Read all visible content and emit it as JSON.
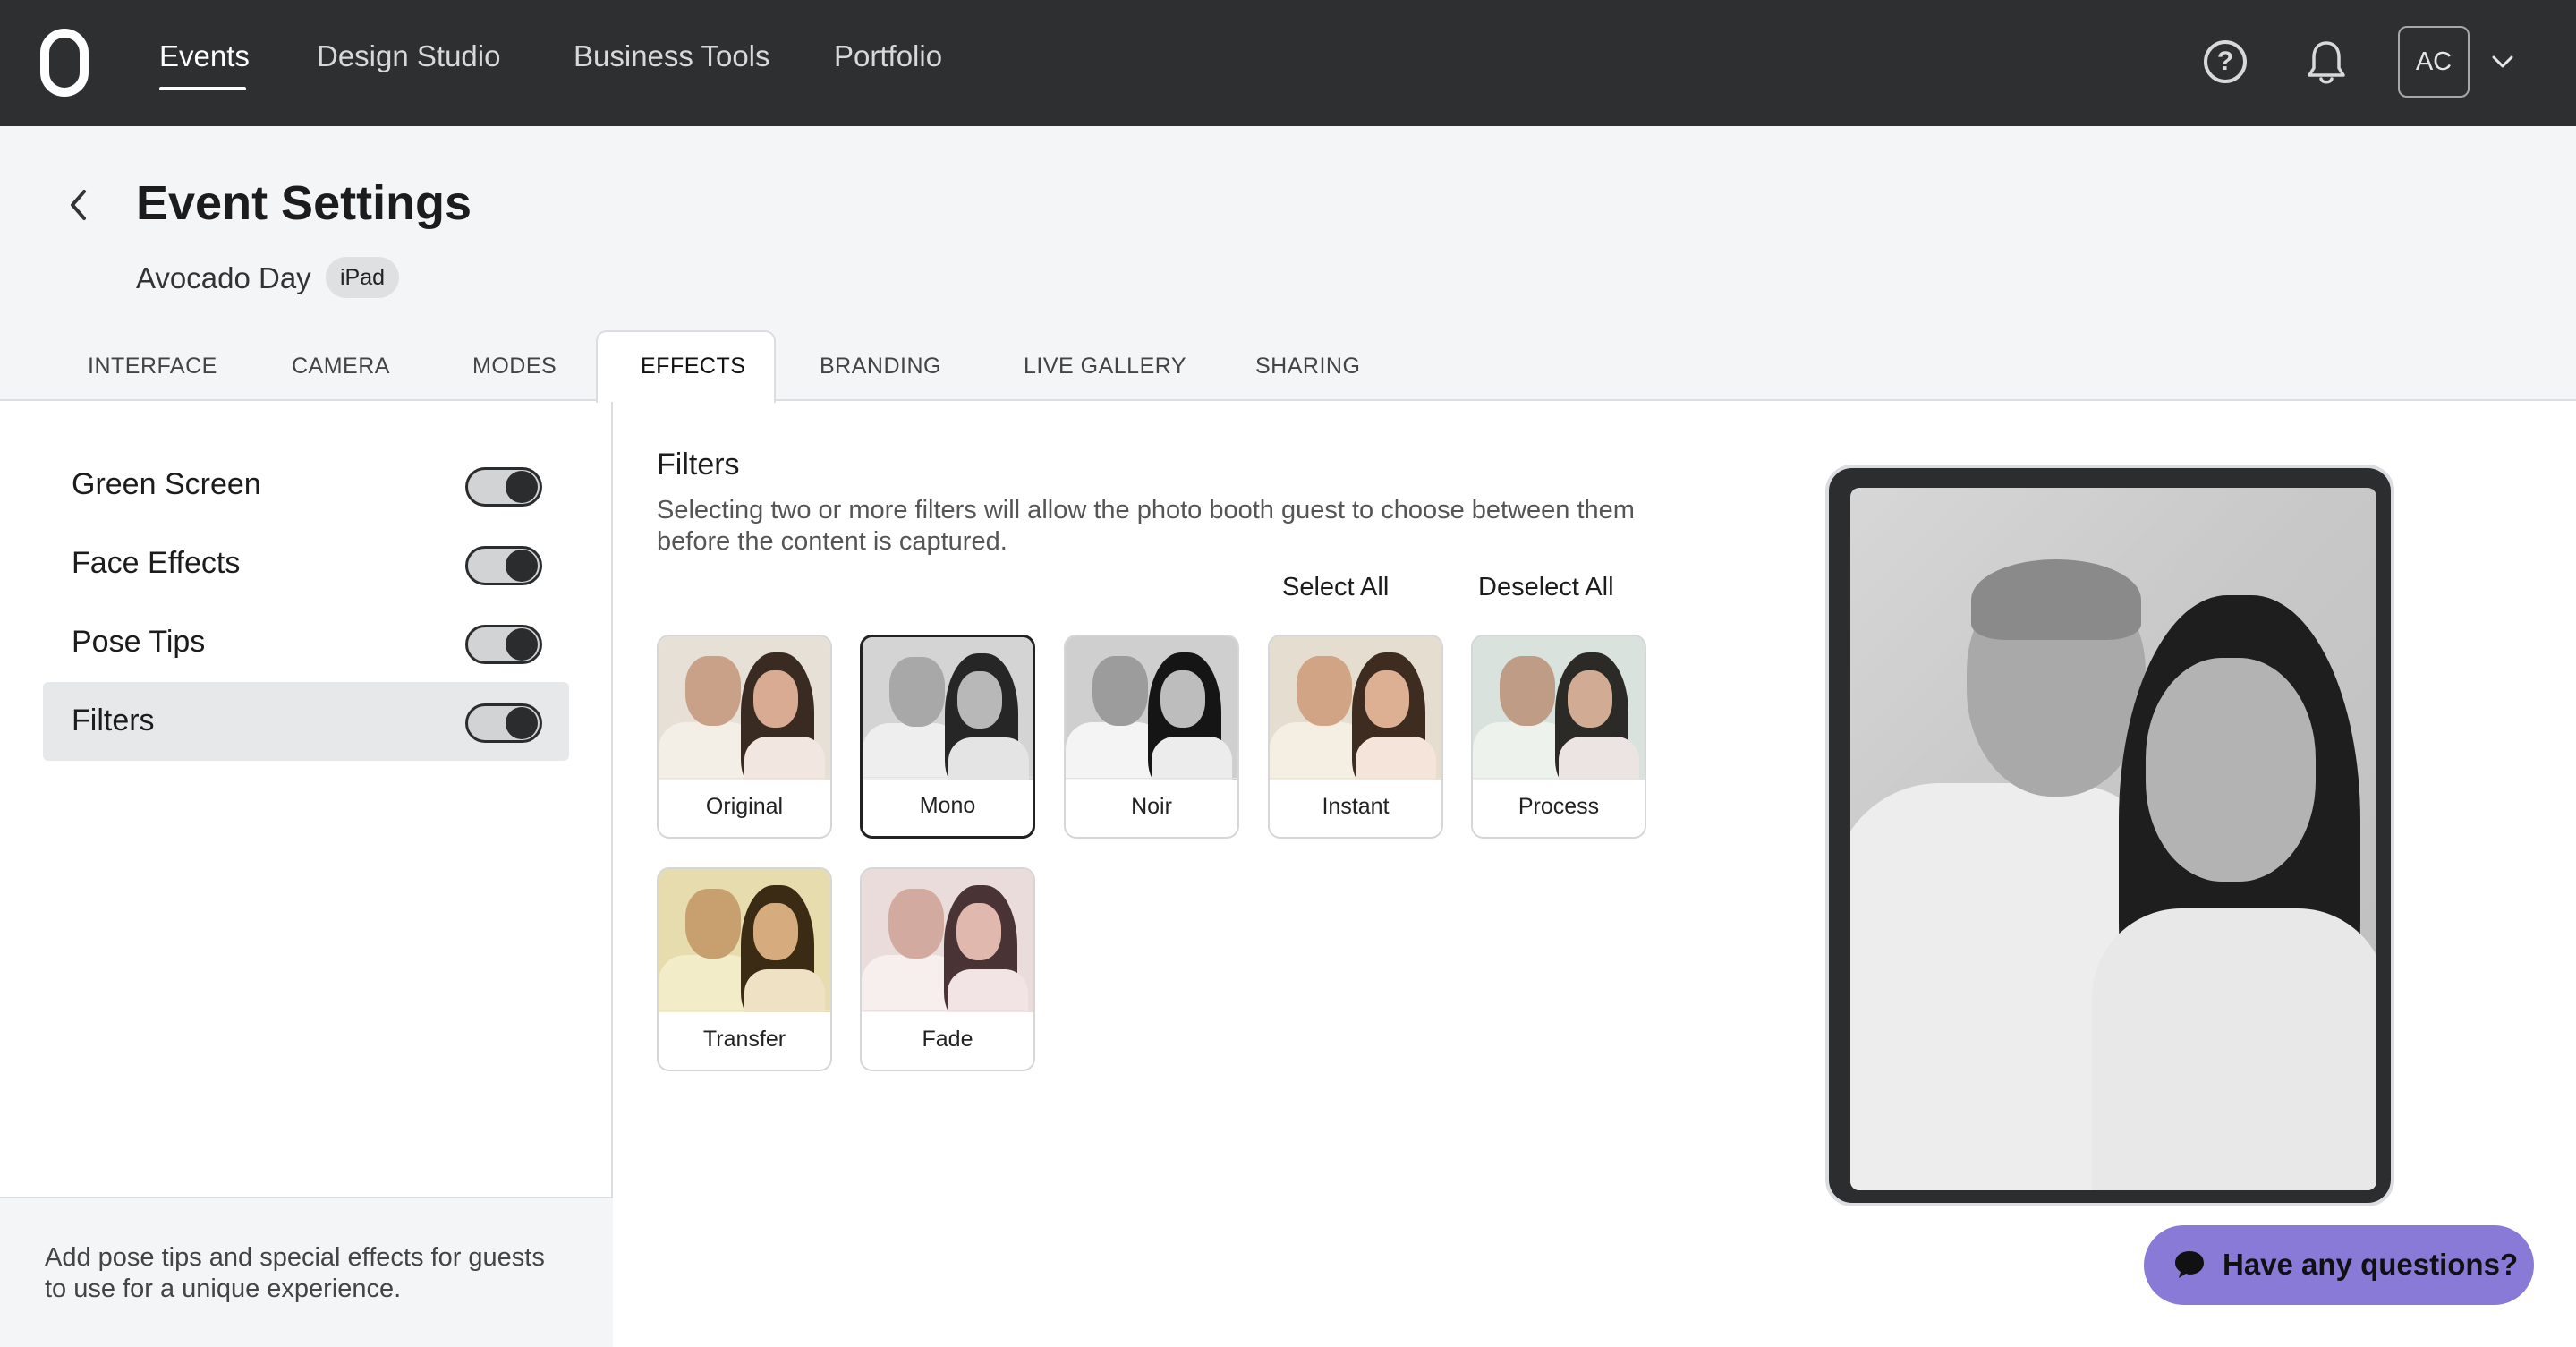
{
  "nav": {
    "items": [
      {
        "label": "Events",
        "active": true
      },
      {
        "label": "Design Studio"
      },
      {
        "label": "Business Tools"
      },
      {
        "label": "Portfolio"
      }
    ],
    "avatar_initials": "AC",
    "icons": [
      "logo-icon",
      "help-icon",
      "bell-icon",
      "chevron-down-icon"
    ]
  },
  "header": {
    "title": "Event Settings",
    "event_name": "Avocado Day",
    "device_badge": "iPad"
  },
  "tabs": [
    {
      "label": "INTERFACE"
    },
    {
      "label": "CAMERA"
    },
    {
      "label": "MODES"
    },
    {
      "label": "EFFECTS",
      "active": true
    },
    {
      "label": "BRANDING"
    },
    {
      "label": "LIVE GALLERY"
    },
    {
      "label": "SHARING"
    }
  ],
  "effects": [
    {
      "label": "Green Screen",
      "enabled": true
    },
    {
      "label": "Face Effects",
      "enabled": true
    },
    {
      "label": "Pose Tips",
      "enabled": true
    },
    {
      "label": "Filters",
      "enabled": true,
      "selected": true
    }
  ],
  "helper_text": "Add pose tips and special effects for guests to use for a unique experience.",
  "filters": {
    "title": "Filters",
    "description": "Selecting two or more filters will allow the photo booth guest to choose between them before the content is captured.",
    "select_all": "Select All",
    "deselect_all": "Deselect All",
    "items": [
      {
        "label": "Original",
        "selected": false
      },
      {
        "label": "Mono",
        "selected": true
      },
      {
        "label": "Noir",
        "selected": false
      },
      {
        "label": "Instant",
        "selected": false
      },
      {
        "label": "Process",
        "selected": false
      },
      {
        "label": "Transfer",
        "selected": false
      },
      {
        "label": "Fade",
        "selected": false
      }
    ]
  },
  "chat": {
    "label": "Have any questions?"
  },
  "colors": {
    "topbar": "#2e2f31",
    "chat_button": "#8a7ad8",
    "toggle_on": "#2b2c2e"
  }
}
